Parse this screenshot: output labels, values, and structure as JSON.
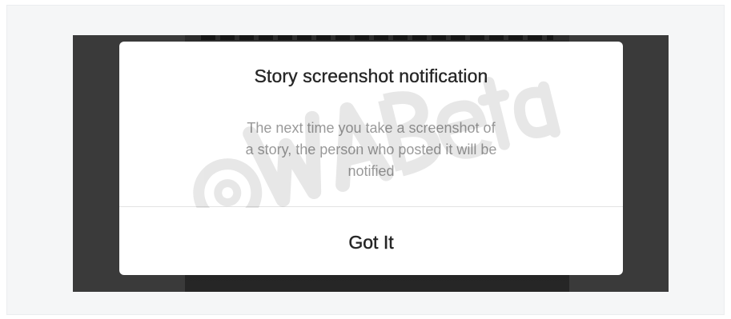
{
  "dialog": {
    "title": "Story screenshot notification",
    "message_lines": [
      "The next time you take a screenshot of",
      "a story, the person who posted it will be",
      "notified"
    ],
    "button_label": "Got It"
  },
  "watermark": {
    "text": "@WABetaInfo"
  },
  "colors": {
    "frame_background": "#f5f6f7",
    "screen_background": "#3a3a3a",
    "dialog_background": "#ffffff",
    "title_text": "#262626",
    "body_text": "#9a9a9a",
    "divider": "#e3e3e3"
  }
}
